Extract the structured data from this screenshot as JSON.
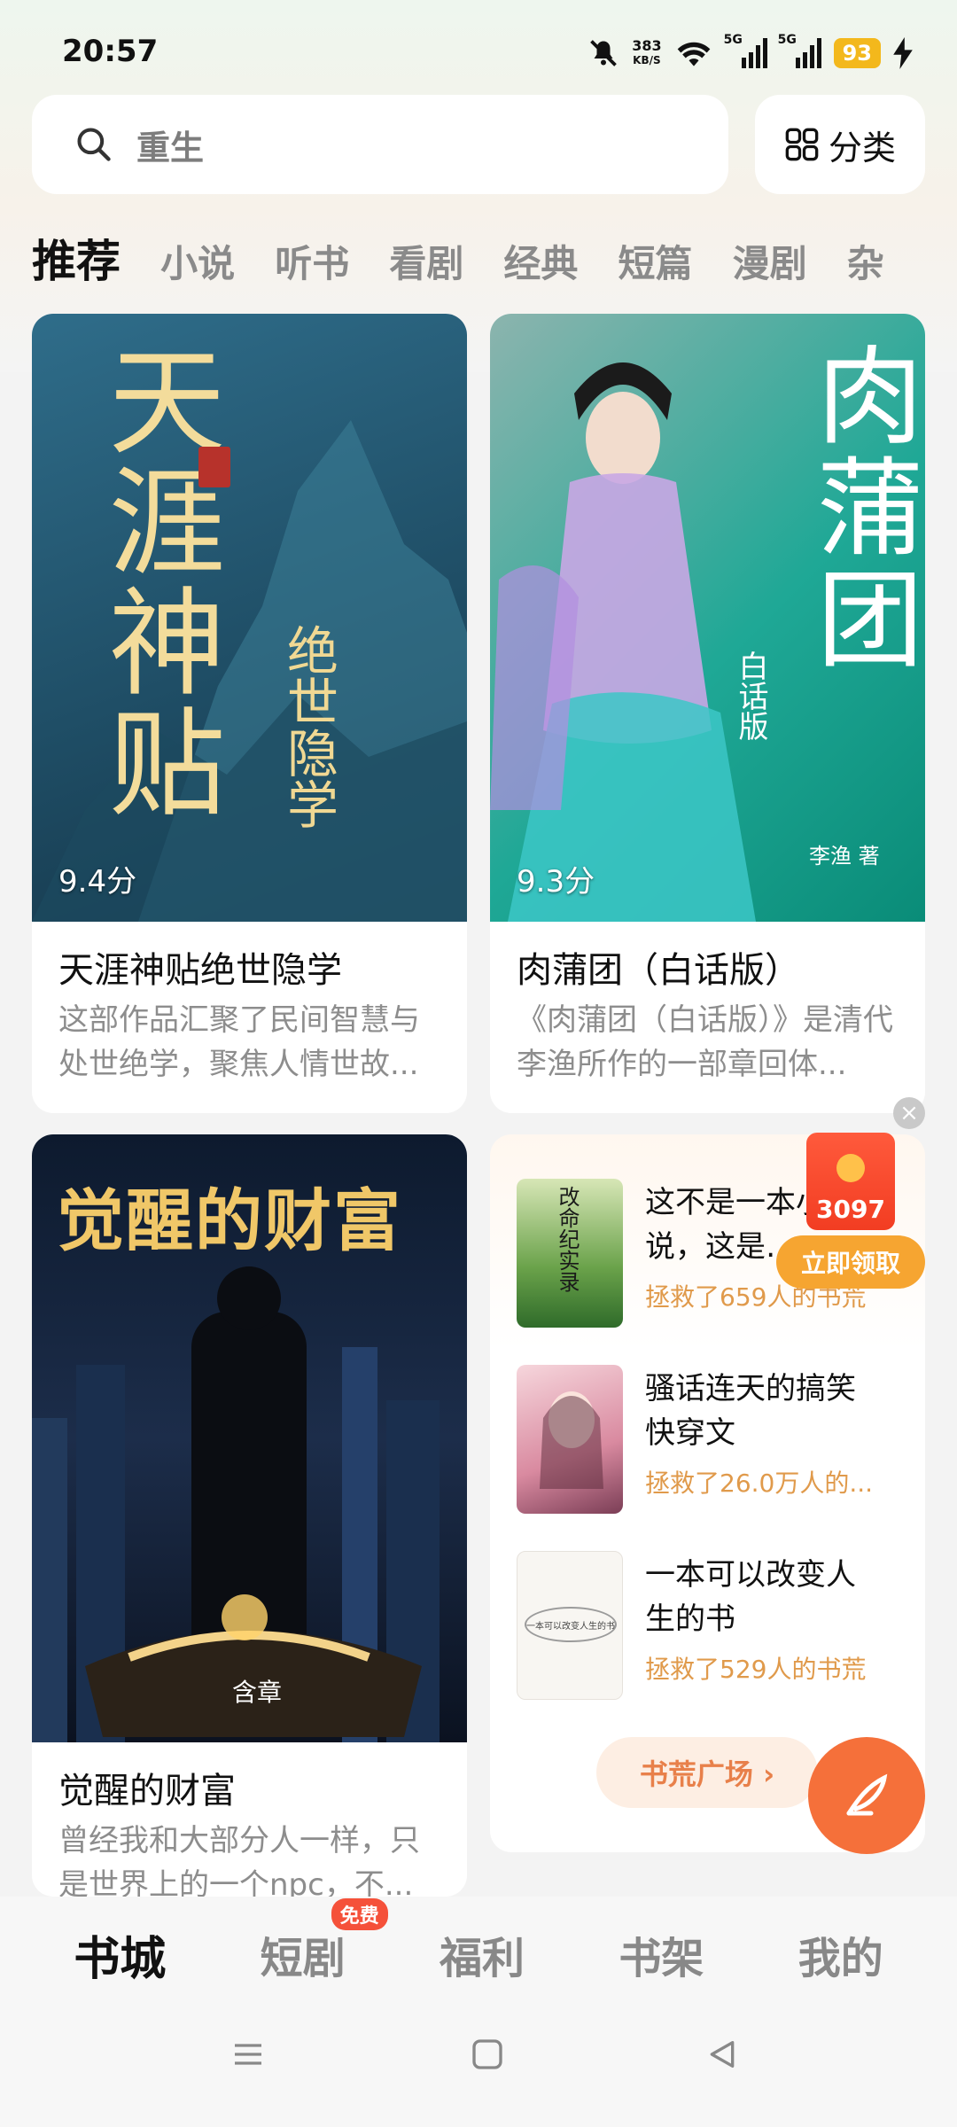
{
  "status": {
    "time": "20:57",
    "net_speed_value": "383",
    "net_speed_unit": "KB/S",
    "sig1_label": "5G",
    "sig2_label": "5G",
    "battery": "93"
  },
  "search": {
    "placeholder": "重生",
    "category_label": "分类"
  },
  "tabs": [
    "推荐",
    "小说",
    "听书",
    "看剧",
    "经典",
    "短篇",
    "漫剧",
    "杂"
  ],
  "books": [
    {
      "cover_title": "天涯神贴",
      "cover_subtitle": "绝世隐学",
      "score": "9.4分",
      "title": "天涯神贴绝世隐学",
      "desc": "这部作品汇聚了民间智慧与处世绝学，聚焦人情世故..."
    },
    {
      "cover_title": "肉蒲团",
      "cover_subtitle": "白话版",
      "cover_author": "李渔 著",
      "score": "9.3分",
      "title": "肉蒲团（白话版）",
      "desc": "《肉蒲团（白话版）》是清代李渔所作的一部章回体..."
    },
    {
      "cover_title": "觉醒的财富",
      "cover_author": "含章",
      "title": "觉醒的财富",
      "desc": "曾经我和大部分人一样，只是世界上的一个npc，不..."
    }
  ],
  "recommend": {
    "items": [
      {
        "title": "这不是一本小说，这是…",
        "sub": "拯救了659人的书荒",
        "thumb_text": "改命纪实录"
      },
      {
        "title": "骚话连天的搞笑快穿文",
        "sub": "拯救了26.0万人的..."
      },
      {
        "title": "一本可以改变人生的书",
        "sub": "拯救了529人的书荒",
        "thumb_text": "一本可以改变人生的书"
      }
    ],
    "plaza_label": "书荒广场 ›"
  },
  "redpacket": {
    "amount": "3097",
    "claim_label": "立即领取",
    "close": "×"
  },
  "bottom_nav": {
    "items": [
      "书城",
      "短剧",
      "福利",
      "书架",
      "我的"
    ],
    "badge": "免费"
  },
  "colors": {
    "accent": "#f5703a",
    "gold": "#f3b81c"
  }
}
